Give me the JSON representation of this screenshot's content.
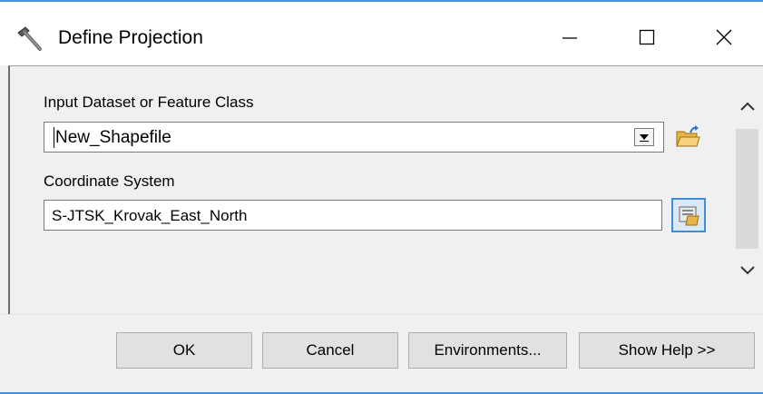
{
  "window": {
    "title": "Define Projection",
    "icon": "hammer-icon",
    "controls": [
      "minimize-icon",
      "maximize-icon",
      "close-icon"
    ]
  },
  "form": {
    "input_label": "Input Dataset or Feature Class",
    "input_value": "New_Shapefile",
    "coord_label": "Coordinate System",
    "coord_value": "S-JTSK_Krovak_East_North"
  },
  "buttons": {
    "ok": "OK",
    "cancel": "Cancel",
    "environments": "Environments...",
    "show_help": "Show Help >>"
  },
  "colors": {
    "accent": "#3c8fd8",
    "window_bg": "#f0f0f0",
    "button_bg": "#e1e1e1"
  }
}
